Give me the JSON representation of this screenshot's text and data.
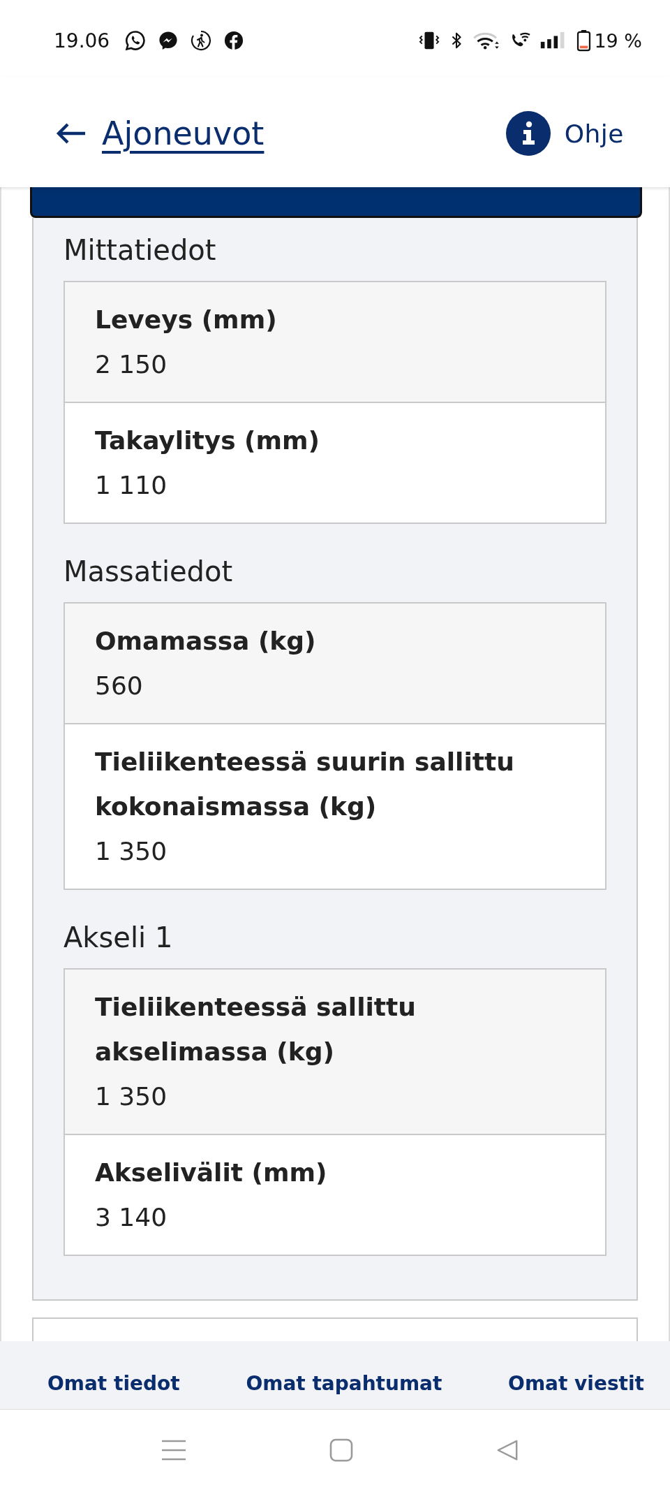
{
  "status_bar": {
    "time": "19.06",
    "battery": "19 %"
  },
  "header": {
    "back_link": "Ajoneuvot",
    "help_link": "Ohje"
  },
  "sections": [
    {
      "title": "Mittatiedot",
      "rows": [
        {
          "label": "Leveys (mm)",
          "value": "2 150"
        },
        {
          "label": "Takaylitys (mm)",
          "value": "1 110"
        }
      ]
    },
    {
      "title": "Massatiedot",
      "rows": [
        {
          "label": "Omamassa (kg)",
          "value": "560"
        },
        {
          "label": "Tieliikenteessä suurin sallittu kokonaismassa (kg)",
          "value": "1 350"
        }
      ]
    },
    {
      "title": "Akseli 1",
      "rows": [
        {
          "label": "Tieliikenteessä sallittu akselimassa (kg)",
          "value": "1 350"
        },
        {
          "label": "Akselivälit (mm)",
          "value": "3 140"
        }
      ]
    }
  ],
  "bottom_nav": [
    "Omat tiedot",
    "Omat tapahtumat",
    "Omat viestit"
  ]
}
